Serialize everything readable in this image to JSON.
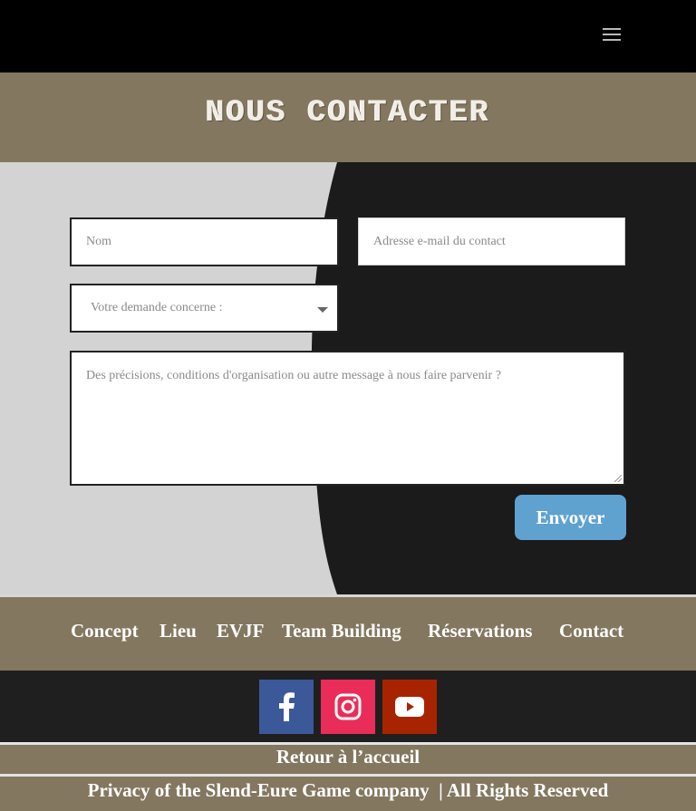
{
  "header": {
    "menu_icon": "hamburger-icon"
  },
  "title": "NOUS CONTACTER",
  "form": {
    "name_placeholder": "Nom",
    "email_placeholder": "Adresse e-mail du contact",
    "select_value": "Votre demande concerne :",
    "message_placeholder": "Des précisions, conditions d'organisation ou autre message à nous faire parvenir ?",
    "submit_label": "Envoyer"
  },
  "nav": {
    "items": [
      {
        "label": "Concept"
      },
      {
        "label": "Lieu"
      },
      {
        "label": "EVJF"
      },
      {
        "label": "Team Building"
      },
      {
        "label": "Réservations"
      },
      {
        "label": "Contact"
      }
    ]
  },
  "social": [
    {
      "name": "facebook",
      "icon": "facebook-icon",
      "color": "#3b5998"
    },
    {
      "name": "instagram",
      "icon": "instagram-icon",
      "color": "#ea2c59"
    },
    {
      "name": "youtube",
      "icon": "youtube-icon",
      "color": "#a82400"
    }
  ],
  "back_link": "Retour à l’accueil",
  "footer": "Privacy of the Slend-Eure Game company  | All Rights Reserved",
  "colors": {
    "band": "#83775f",
    "dark": "#1b1b1b",
    "accent": "#5fa2cf",
    "light_panel": "#d3d3d3"
  }
}
